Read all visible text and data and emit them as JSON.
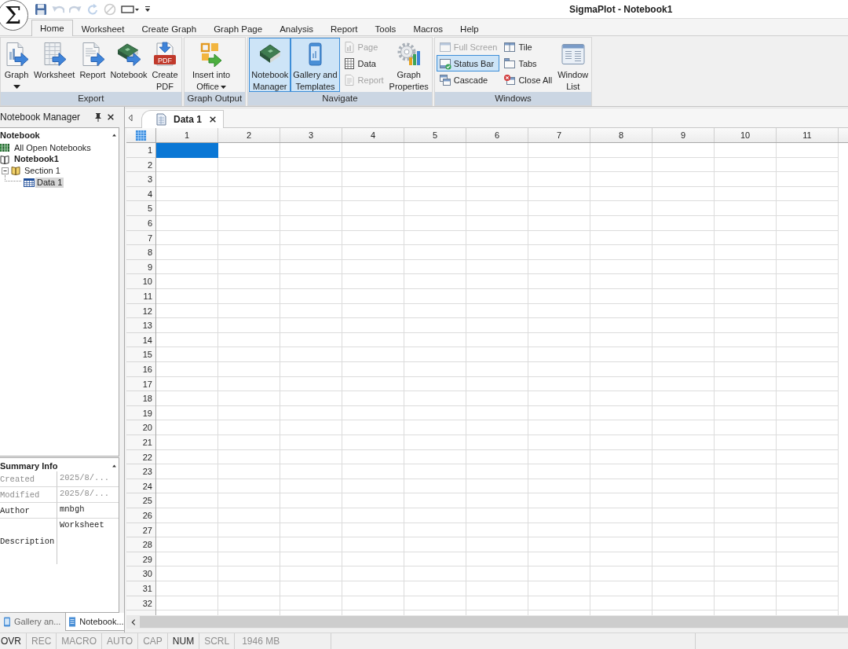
{
  "app_button": {
    "symbol": "Σ"
  },
  "quick_access": [
    {
      "kind": "save",
      "disabled": false
    },
    {
      "kind": "undo",
      "disabled": true
    },
    {
      "kind": "redo",
      "disabled": true
    },
    {
      "kind": "refresh",
      "disabled": true
    },
    {
      "kind": "stop",
      "disabled": true
    },
    {
      "kind": "window",
      "disabled": false
    },
    {
      "kind": "customize",
      "disabled": false
    }
  ],
  "window": {
    "title": "SigmaPlot - Notebook1"
  },
  "ribbon_tabs": [
    {
      "label": "Home",
      "selected": true
    },
    {
      "label": "Worksheet",
      "selected": false
    },
    {
      "label": "Create Graph",
      "selected": false
    },
    {
      "label": "Graph Page",
      "selected": false
    },
    {
      "label": "Analysis",
      "selected": false
    },
    {
      "label": "Report",
      "selected": false
    },
    {
      "label": "Tools",
      "selected": false
    },
    {
      "label": "Macros",
      "selected": false
    },
    {
      "label": "Help",
      "selected": false
    }
  ],
  "ribbon": {
    "groups": [
      {
        "title": "Export",
        "items": [
          {
            "kind": "graph",
            "label": "Graph",
            "dropdown": true,
            "checked": false
          },
          {
            "kind": "worksheet",
            "label": "Worksheet",
            "dropdown": false,
            "checked": false
          },
          {
            "kind": "report",
            "label": "Report",
            "dropdown": false,
            "checked": false
          },
          {
            "kind": "notebook",
            "label": "Notebook",
            "dropdown": false,
            "checked": false
          },
          {
            "kind": "pdf",
            "label": "Create PDF",
            "icon_text": "PDF",
            "dropdown": false,
            "checked": false
          }
        ]
      },
      {
        "title": "Graph Output",
        "items": [
          {
            "kind": "office",
            "label": "Insert into Office",
            "dropdown": true,
            "checked": false
          }
        ]
      },
      {
        "title": "Navigate",
        "items": [
          {
            "kind": "manager",
            "label": "Notebook Manager",
            "dropdown": false,
            "checked": true
          },
          {
            "kind": "gallery",
            "label": "Gallery and Templates",
            "dropdown": false,
            "checked": true
          },
          {
            "kind": "stack",
            "buttons": [
              {
                "kind": "page",
                "label": "Page",
                "disabled": true,
                "checked": false
              },
              {
                "kind": "data",
                "label": "Data",
                "disabled": false,
                "checked": false
              },
              {
                "kind": "report",
                "label": "Report",
                "disabled": true,
                "checked": false
              }
            ]
          },
          {
            "kind": "properties",
            "label": "Graph Properties",
            "dropdown": false,
            "checked": false
          }
        ]
      },
      {
        "title": "Windows",
        "items": [
          {
            "kind": "stack",
            "buttons": [
              {
                "kind": "fullscreen",
                "label": "Full Screen",
                "disabled": true,
                "checked": false
              },
              {
                "kind": "statusbar",
                "label": "Status Bar",
                "disabled": false,
                "checked": true
              },
              {
                "kind": "cascade",
                "label": "Cascade",
                "disabled": false,
                "checked": false
              }
            ]
          },
          {
            "kind": "stack",
            "buttons": [
              {
                "kind": "tile",
                "label": "Tile",
                "disabled": false,
                "checked": false
              },
              {
                "kind": "tabs",
                "label": "Tabs",
                "disabled": false,
                "checked": false
              },
              {
                "kind": "closeall",
                "label": "Close All",
                "disabled": false,
                "checked": false
              }
            ]
          },
          {
            "kind": "windowlist",
            "label": "Window List",
            "dropdown": false,
            "checked": false
          }
        ]
      }
    ]
  },
  "notebook_manager": {
    "title": "Notebook Manager",
    "tree_header": "Notebook",
    "tree": [
      {
        "kind": "notebooks",
        "label": "All Open Notebooks",
        "selected": false
      },
      {
        "kind": "notebook",
        "label": "Notebook1",
        "selected": false,
        "children": [
          {
            "kind": "section",
            "label": "Section 1",
            "selected": false,
            "expanded": true,
            "children": [
              {
                "kind": "worksheet",
                "label": "Data 1",
                "selected": true
              }
            ]
          }
        ]
      }
    ],
    "summary": {
      "title": "Summary Info",
      "rows": [
        {
          "kind": "field",
          "name": "Created",
          "value": "2025/8/...",
          "disabled": true
        },
        {
          "kind": "field",
          "name": "Modified",
          "value": "2025/8/...",
          "disabled": true
        },
        {
          "kind": "field",
          "name": "Author",
          "value": "mnbgh",
          "disabled": false
        },
        {
          "kind": "memo",
          "name": "Description",
          "value": "Worksheet",
          "disabled": false
        }
      ]
    },
    "tabs": [
      {
        "kind": "gallery",
        "label": "Gallery an...",
        "selected": false
      },
      {
        "kind": "notebook",
        "label": "Notebook...",
        "selected": true
      }
    ]
  },
  "document_tabs": [
    {
      "label": "Data 1",
      "selected": true
    }
  ],
  "worksheet": {
    "columns": [
      "1",
      "2",
      "3",
      "4",
      "5",
      "6",
      "7",
      "8",
      "9",
      "10",
      "11"
    ],
    "rows": [
      {
        "label": "1",
        "cells": [
          {
            "selected": true
          },
          {
            "selected": false
          },
          {
            "selected": false
          },
          {
            "selected": false
          },
          {
            "selected": false
          },
          {
            "selected": false
          },
          {
            "selected": false
          },
          {
            "selected": false
          },
          {
            "selected": false
          },
          {
            "selected": false
          },
          {
            "selected": false
          }
        ]
      },
      {
        "label": "2",
        "cells": [
          {
            "selected": false
          },
          {
            "selected": false
          },
          {
            "selected": false
          },
          {
            "selected": false
          },
          {
            "selected": false
          },
          {
            "selected": false
          },
          {
            "selected": false
          },
          {
            "selected": false
          },
          {
            "selected": false
          },
          {
            "selected": false
          },
          {
            "selected": false
          }
        ]
      },
      {
        "label": "3",
        "cells": [
          {
            "selected": false
          },
          {
            "selected": false
          },
          {
            "selected": false
          },
          {
            "selected": false
          },
          {
            "selected": false
          },
          {
            "selected": false
          },
          {
            "selected": false
          },
          {
            "selected": false
          },
          {
            "selected": false
          },
          {
            "selected": false
          },
          {
            "selected": false
          }
        ]
      },
      {
        "label": "4",
        "cells": [
          {
            "selected": false
          },
          {
            "selected": false
          },
          {
            "selected": false
          },
          {
            "selected": false
          },
          {
            "selected": false
          },
          {
            "selected": false
          },
          {
            "selected": false
          },
          {
            "selected": false
          },
          {
            "selected": false
          },
          {
            "selected": false
          },
          {
            "selected": false
          }
        ]
      },
      {
        "label": "5",
        "cells": [
          {
            "selected": false
          },
          {
            "selected": false
          },
          {
            "selected": false
          },
          {
            "selected": false
          },
          {
            "selected": false
          },
          {
            "selected": false
          },
          {
            "selected": false
          },
          {
            "selected": false
          },
          {
            "selected": false
          },
          {
            "selected": false
          },
          {
            "selected": false
          }
        ]
      },
      {
        "label": "6",
        "cells": [
          {
            "selected": false
          },
          {
            "selected": false
          },
          {
            "selected": false
          },
          {
            "selected": false
          },
          {
            "selected": false
          },
          {
            "selected": false
          },
          {
            "selected": false
          },
          {
            "selected": false
          },
          {
            "selected": false
          },
          {
            "selected": false
          },
          {
            "selected": false
          }
        ]
      },
      {
        "label": "7",
        "cells": [
          {
            "selected": false
          },
          {
            "selected": false
          },
          {
            "selected": false
          },
          {
            "selected": false
          },
          {
            "selected": false
          },
          {
            "selected": false
          },
          {
            "selected": false
          },
          {
            "selected": false
          },
          {
            "selected": false
          },
          {
            "selected": false
          },
          {
            "selected": false
          }
        ]
      },
      {
        "label": "8",
        "cells": [
          {
            "selected": false
          },
          {
            "selected": false
          },
          {
            "selected": false
          },
          {
            "selected": false
          },
          {
            "selected": false
          },
          {
            "selected": false
          },
          {
            "selected": false
          },
          {
            "selected": false
          },
          {
            "selected": false
          },
          {
            "selected": false
          },
          {
            "selected": false
          }
        ]
      },
      {
        "label": "9",
        "cells": [
          {
            "selected": false
          },
          {
            "selected": false
          },
          {
            "selected": false
          },
          {
            "selected": false
          },
          {
            "selected": false
          },
          {
            "selected": false
          },
          {
            "selected": false
          },
          {
            "selected": false
          },
          {
            "selected": false
          },
          {
            "selected": false
          },
          {
            "selected": false
          }
        ]
      },
      {
        "label": "10",
        "cells": [
          {
            "selected": false
          },
          {
            "selected": false
          },
          {
            "selected": false
          },
          {
            "selected": false
          },
          {
            "selected": false
          },
          {
            "selected": false
          },
          {
            "selected": false
          },
          {
            "selected": false
          },
          {
            "selected": false
          },
          {
            "selected": false
          },
          {
            "selected": false
          }
        ]
      },
      {
        "label": "11",
        "cells": [
          {
            "selected": false
          },
          {
            "selected": false
          },
          {
            "selected": false
          },
          {
            "selected": false
          },
          {
            "selected": false
          },
          {
            "selected": false
          },
          {
            "selected": false
          },
          {
            "selected": false
          },
          {
            "selected": false
          },
          {
            "selected": false
          },
          {
            "selected": false
          }
        ]
      },
      {
        "label": "12",
        "cells": [
          {
            "selected": false
          },
          {
            "selected": false
          },
          {
            "selected": false
          },
          {
            "selected": false
          },
          {
            "selected": false
          },
          {
            "selected": false
          },
          {
            "selected": false
          },
          {
            "selected": false
          },
          {
            "selected": false
          },
          {
            "selected": false
          },
          {
            "selected": false
          }
        ]
      },
      {
        "label": "13",
        "cells": [
          {
            "selected": false
          },
          {
            "selected": false
          },
          {
            "selected": false
          },
          {
            "selected": false
          },
          {
            "selected": false
          },
          {
            "selected": false
          },
          {
            "selected": false
          },
          {
            "selected": false
          },
          {
            "selected": false
          },
          {
            "selected": false
          },
          {
            "selected": false
          }
        ]
      },
      {
        "label": "14",
        "cells": [
          {
            "selected": false
          },
          {
            "selected": false
          },
          {
            "selected": false
          },
          {
            "selected": false
          },
          {
            "selected": false
          },
          {
            "selected": false
          },
          {
            "selected": false
          },
          {
            "selected": false
          },
          {
            "selected": false
          },
          {
            "selected": false
          },
          {
            "selected": false
          }
        ]
      },
      {
        "label": "15",
        "cells": [
          {
            "selected": false
          },
          {
            "selected": false
          },
          {
            "selected": false
          },
          {
            "selected": false
          },
          {
            "selected": false
          },
          {
            "selected": false
          },
          {
            "selected": false
          },
          {
            "selected": false
          },
          {
            "selected": false
          },
          {
            "selected": false
          },
          {
            "selected": false
          }
        ]
      },
      {
        "label": "16",
        "cells": [
          {
            "selected": false
          },
          {
            "selected": false
          },
          {
            "selected": false
          },
          {
            "selected": false
          },
          {
            "selected": false
          },
          {
            "selected": false
          },
          {
            "selected": false
          },
          {
            "selected": false
          },
          {
            "selected": false
          },
          {
            "selected": false
          },
          {
            "selected": false
          }
        ]
      },
      {
        "label": "17",
        "cells": [
          {
            "selected": false
          },
          {
            "selected": false
          },
          {
            "selected": false
          },
          {
            "selected": false
          },
          {
            "selected": false
          },
          {
            "selected": false
          },
          {
            "selected": false
          },
          {
            "selected": false
          },
          {
            "selected": false
          },
          {
            "selected": false
          },
          {
            "selected": false
          }
        ]
      },
      {
        "label": "18",
        "cells": [
          {
            "selected": false
          },
          {
            "selected": false
          },
          {
            "selected": false
          },
          {
            "selected": false
          },
          {
            "selected": false
          },
          {
            "selected": false
          },
          {
            "selected": false
          },
          {
            "selected": false
          },
          {
            "selected": false
          },
          {
            "selected": false
          },
          {
            "selected": false
          }
        ]
      },
      {
        "label": "19",
        "cells": [
          {
            "selected": false
          },
          {
            "selected": false
          },
          {
            "selected": false
          },
          {
            "selected": false
          },
          {
            "selected": false
          },
          {
            "selected": false
          },
          {
            "selected": false
          },
          {
            "selected": false
          },
          {
            "selected": false
          },
          {
            "selected": false
          },
          {
            "selected": false
          }
        ]
      },
      {
        "label": "20",
        "cells": [
          {
            "selected": false
          },
          {
            "selected": false
          },
          {
            "selected": false
          },
          {
            "selected": false
          },
          {
            "selected": false
          },
          {
            "selected": false
          },
          {
            "selected": false
          },
          {
            "selected": false
          },
          {
            "selected": false
          },
          {
            "selected": false
          },
          {
            "selected": false
          }
        ]
      },
      {
        "label": "21",
        "cells": [
          {
            "selected": false
          },
          {
            "selected": false
          },
          {
            "selected": false
          },
          {
            "selected": false
          },
          {
            "selected": false
          },
          {
            "selected": false
          },
          {
            "selected": false
          },
          {
            "selected": false
          },
          {
            "selected": false
          },
          {
            "selected": false
          },
          {
            "selected": false
          }
        ]
      },
      {
        "label": "22",
        "cells": [
          {
            "selected": false
          },
          {
            "selected": false
          },
          {
            "selected": false
          },
          {
            "selected": false
          },
          {
            "selected": false
          },
          {
            "selected": false
          },
          {
            "selected": false
          },
          {
            "selected": false
          },
          {
            "selected": false
          },
          {
            "selected": false
          },
          {
            "selected": false
          }
        ]
      },
      {
        "label": "23",
        "cells": [
          {
            "selected": false
          },
          {
            "selected": false
          },
          {
            "selected": false
          },
          {
            "selected": false
          },
          {
            "selected": false
          },
          {
            "selected": false
          },
          {
            "selected": false
          },
          {
            "selected": false
          },
          {
            "selected": false
          },
          {
            "selected": false
          },
          {
            "selected": false
          }
        ]
      },
      {
        "label": "24",
        "cells": [
          {
            "selected": false
          },
          {
            "selected": false
          },
          {
            "selected": false
          },
          {
            "selected": false
          },
          {
            "selected": false
          },
          {
            "selected": false
          },
          {
            "selected": false
          },
          {
            "selected": false
          },
          {
            "selected": false
          },
          {
            "selected": false
          },
          {
            "selected": false
          }
        ]
      },
      {
        "label": "25",
        "cells": [
          {
            "selected": false
          },
          {
            "selected": false
          },
          {
            "selected": false
          },
          {
            "selected": false
          },
          {
            "selected": false
          },
          {
            "selected": false
          },
          {
            "selected": false
          },
          {
            "selected": false
          },
          {
            "selected": false
          },
          {
            "selected": false
          },
          {
            "selected": false
          }
        ]
      },
      {
        "label": "26",
        "cells": [
          {
            "selected": false
          },
          {
            "selected": false
          },
          {
            "selected": false
          },
          {
            "selected": false
          },
          {
            "selected": false
          },
          {
            "selected": false
          },
          {
            "selected": false
          },
          {
            "selected": false
          },
          {
            "selected": false
          },
          {
            "selected": false
          },
          {
            "selected": false
          }
        ]
      },
      {
        "label": "27",
        "cells": [
          {
            "selected": false
          },
          {
            "selected": false
          },
          {
            "selected": false
          },
          {
            "selected": false
          },
          {
            "selected": false
          },
          {
            "selected": false
          },
          {
            "selected": false
          },
          {
            "selected": false
          },
          {
            "selected": false
          },
          {
            "selected": false
          },
          {
            "selected": false
          }
        ]
      },
      {
        "label": "28",
        "cells": [
          {
            "selected": false
          },
          {
            "selected": false
          },
          {
            "selected": false
          },
          {
            "selected": false
          },
          {
            "selected": false
          },
          {
            "selected": false
          },
          {
            "selected": false
          },
          {
            "selected": false
          },
          {
            "selected": false
          },
          {
            "selected": false
          },
          {
            "selected": false
          }
        ]
      },
      {
        "label": "29",
        "cells": [
          {
            "selected": false
          },
          {
            "selected": false
          },
          {
            "selected": false
          },
          {
            "selected": false
          },
          {
            "selected": false
          },
          {
            "selected": false
          },
          {
            "selected": false
          },
          {
            "selected": false
          },
          {
            "selected": false
          },
          {
            "selected": false
          },
          {
            "selected": false
          }
        ]
      },
      {
        "label": "30",
        "cells": [
          {
            "selected": false
          },
          {
            "selected": false
          },
          {
            "selected": false
          },
          {
            "selected": false
          },
          {
            "selected": false
          },
          {
            "selected": false
          },
          {
            "selected": false
          },
          {
            "selected": false
          },
          {
            "selected": false
          },
          {
            "selected": false
          },
          {
            "selected": false
          }
        ]
      },
      {
        "label": "31",
        "cells": [
          {
            "selected": false
          },
          {
            "selected": false
          },
          {
            "selected": false
          },
          {
            "selected": false
          },
          {
            "selected": false
          },
          {
            "selected": false
          },
          {
            "selected": false
          },
          {
            "selected": false
          },
          {
            "selected": false
          },
          {
            "selected": false
          },
          {
            "selected": false
          }
        ]
      },
      {
        "label": "32",
        "cells": [
          {
            "selected": false
          },
          {
            "selected": false
          },
          {
            "selected": false
          },
          {
            "selected": false
          },
          {
            "selected": false
          },
          {
            "selected": false
          },
          {
            "selected": false
          },
          {
            "selected": false
          },
          {
            "selected": false
          },
          {
            "selected": false
          },
          {
            "selected": false
          }
        ]
      }
    ]
  },
  "status_bar": {
    "indicators": [
      {
        "label": "OVR",
        "on": true
      },
      {
        "label": "REC",
        "on": false
      },
      {
        "label": "MACRO",
        "on": false
      },
      {
        "label": "AUTO",
        "on": false
      },
      {
        "label": "CAP",
        "on": false
      },
      {
        "label": "NUM",
        "on": true
      },
      {
        "label": "SCRL",
        "on": false
      }
    ],
    "memory": "1946 MB"
  }
}
